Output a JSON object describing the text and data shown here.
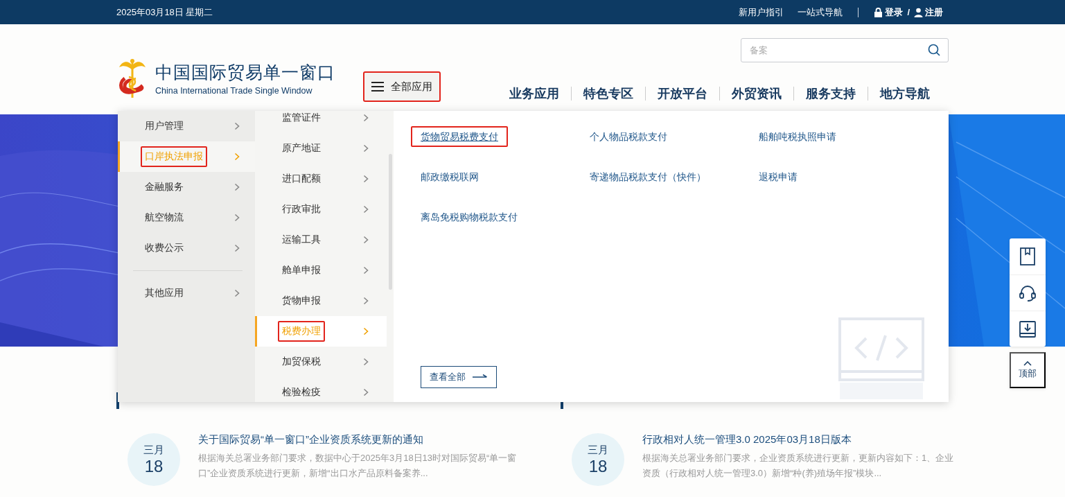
{
  "top_bar": {
    "date": "2025年03月18日 星期二",
    "links": [
      "新用户指引",
      "一站式导航"
    ],
    "login": "登录",
    "slash": "/",
    "register": "注册"
  },
  "header": {
    "logo_title": "中国国际贸易单一窗口",
    "logo_subtitle": "China International Trade Single Window",
    "all_apps": {
      "label": "全部应用",
      "annotated": true
    },
    "search": {
      "placeholder": "备案"
    },
    "nav": [
      "业务应用",
      "特色专区",
      "开放平台",
      "外贸资讯",
      "服务支持",
      "地方导航"
    ]
  },
  "menu": {
    "categories": [
      {
        "label": "用户管理",
        "selected": false,
        "annotated": false
      },
      {
        "label": "口岸执法申报",
        "selected": true,
        "annotated": true
      },
      {
        "label": "金融服务",
        "selected": false,
        "annotated": false
      },
      {
        "label": "航空物流",
        "selected": false,
        "annotated": false
      },
      {
        "label": "收费公示",
        "selected": false,
        "annotated": false
      }
    ],
    "other": {
      "label": "其他应用"
    },
    "subcategories": [
      {
        "label": "监管证件",
        "selected": false,
        "annotated": false
      },
      {
        "label": "原产地证",
        "selected": false,
        "annotated": false
      },
      {
        "label": "进口配额",
        "selected": false,
        "annotated": false
      },
      {
        "label": "行政审批",
        "selected": false,
        "annotated": false
      },
      {
        "label": "运输工具",
        "selected": false,
        "annotated": false
      },
      {
        "label": "舱单申报",
        "selected": false,
        "annotated": false
      },
      {
        "label": "货物申报",
        "selected": false,
        "annotated": false
      },
      {
        "label": "税费办理",
        "selected": true,
        "annotated": true
      },
      {
        "label": "加贸保税",
        "selected": false,
        "annotated": false
      },
      {
        "label": "检验检疫",
        "selected": false,
        "annotated": false
      }
    ],
    "links": [
      {
        "label": "货物贸易税费支付",
        "hovered": true,
        "annotated": true
      },
      {
        "label": "个人物品税款支付",
        "hovered": false,
        "annotated": false
      },
      {
        "label": "船舶吨税执照申请",
        "hovered": false,
        "annotated": false
      },
      {
        "label": "邮政缴税联网",
        "hovered": false,
        "annotated": false
      },
      {
        "label": "寄递物品税款支付（快件）",
        "hovered": false,
        "annotated": false
      },
      {
        "label": "退税申请",
        "hovered": false,
        "annotated": false
      },
      {
        "label": "离岛免税购物税款支付",
        "hovered": false,
        "annotated": false
      }
    ],
    "view_all": "查看全部"
  },
  "news": [
    {
      "items": [
        {
          "month": "三月",
          "day": "18",
          "title": "关于国际贸易“单一窗口”企业资质系统更新的通知",
          "summary": "根据海关总署业务部门要求，数据中心于2025年3月18日13时对国际贸易“单一窗口”企业资质系统进行更新，新增“出口水产品原料备案养..."
        }
      ]
    },
    {
      "items": [
        {
          "month": "三月",
          "day": "18",
          "title": "行政相对人统一管理3.0 2025年03月18日版本",
          "summary": "根据海关总署业务部门要求，企业资质系统进行更新，更新内容如下：1、企业资质（行政相对人统一管理3.0）新增“种(养)殖场年报”模块..."
        }
      ]
    }
  ],
  "side_tools": {
    "top_label": "顶部"
  }
}
